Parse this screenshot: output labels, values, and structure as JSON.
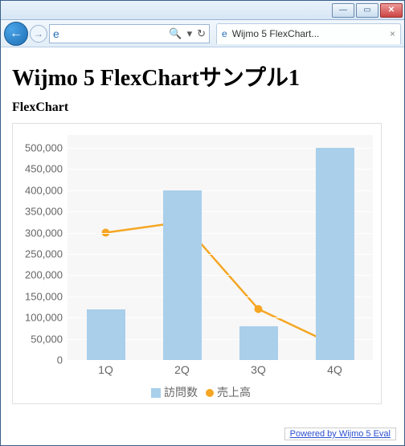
{
  "window": {
    "tab_title": "Wijmo 5 FlexChart..."
  },
  "page": {
    "title": "Wijmo 5 FlexChartサンプル1",
    "section": "FlexChart",
    "footer": "Powered by Wijmo 5 Eval"
  },
  "chart_data": {
    "type": "bar+line",
    "categories": [
      "1Q",
      "2Q",
      "3Q",
      "4Q"
    ],
    "y_ticks": [
      0,
      50000,
      100000,
      150000,
      200000,
      250000,
      300000,
      350000,
      400000,
      450000,
      500000
    ],
    "y_tick_labels": [
      "0",
      "50,000",
      "100,000",
      "150,000",
      "200,000",
      "250,000",
      "300,000",
      "350,000",
      "400,000",
      "450,000",
      "500,000"
    ],
    "ylim": [
      0,
      530000
    ],
    "series": [
      {
        "name": "訪問数",
        "type": "bar",
        "color": "#a9cfeb",
        "values": [
          120000,
          400000,
          80000,
          500000
        ]
      },
      {
        "name": "売上高",
        "type": "line",
        "color": "#f5a623",
        "values": [
          300000,
          325000,
          120000,
          35000
        ]
      }
    ]
  }
}
